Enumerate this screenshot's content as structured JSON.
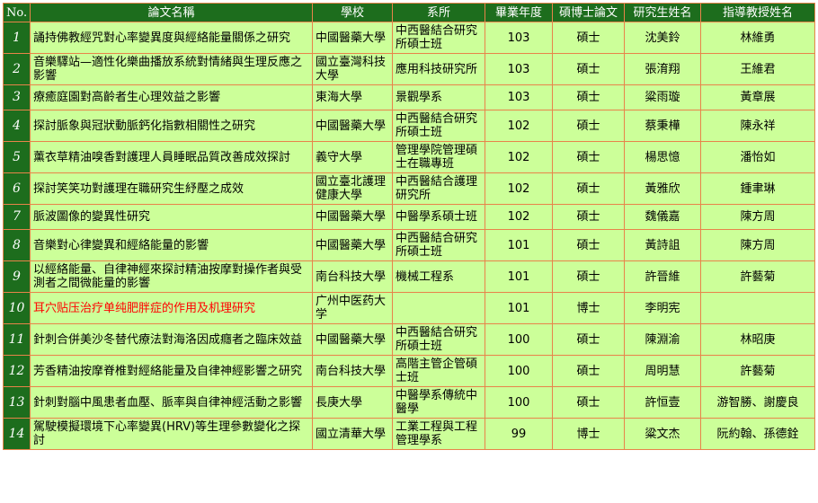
{
  "colors": {
    "header_bg": "#1d6d1d",
    "header_text": "#ffffff",
    "cell_bg": "#ccff99",
    "border": "#e8834a",
    "highlight_text": "#ff0000"
  },
  "table": {
    "headers": [
      "No.",
      "論文名稱",
      "學校",
      "系所",
      "畢業年度",
      "碩博士論文",
      "研究生姓名",
      "指導教授姓名"
    ],
    "rows": [
      {
        "no": "1",
        "title": "誦持佛教經咒對心率變異度與經絡能量關係之研究",
        "school": "中國醫藥大學",
        "dept": "中西醫結合研究所碩士班",
        "year": "103",
        "degree": "碩士",
        "student": "沈美鈴",
        "advisor": "林維勇"
      },
      {
        "no": "2",
        "title": "音樂驛站—適性化樂曲播放系統對情緒與生理反應之影響",
        "school": "國立臺灣科技大學",
        "dept": "應用科技研究所",
        "year": "103",
        "degree": "碩士",
        "student": "張淯翔",
        "advisor": "王維君"
      },
      {
        "no": "3",
        "title": "療癒庭園對高齡者生心理效益之影響",
        "school": "東海大學",
        "dept": "景觀學系",
        "year": "103",
        "degree": "碩士",
        "student": "粱雨璇",
        "advisor": "黃章展"
      },
      {
        "no": "4",
        "title": "探討脈象與冠狀動脈鈣化指數相關性之研究",
        "school": "中國醫藥大學",
        "dept": "中西醫結合研究所碩士班",
        "year": "102",
        "degree": "碩士",
        "student": "蔡秉樺",
        "advisor": "陳永祥"
      },
      {
        "no": "5",
        "title": "薰衣草精油嗅香對護理人員睡眠品質改善成效探討",
        "school": "義守大學",
        "dept": "管理學院管理碩士在職專班",
        "year": "102",
        "degree": "碩士",
        "student": "楊思憶",
        "advisor": "潘怡如"
      },
      {
        "no": "6",
        "title": "探討笑笑功對護理在職研究生紓壓之成效",
        "school": "國立臺北護理健康大學",
        "dept": "中西醫結合護理研究所",
        "year": "102",
        "degree": "碩士",
        "student": "黃雅欣",
        "advisor": "鍾聿琳"
      },
      {
        "no": "7",
        "title": "脈波圖像的變異性研究",
        "school": "中國醫藥大學",
        "dept": "中醫學系碩士班",
        "year": "102",
        "degree": "碩士",
        "student": "魏儀嘉",
        "advisor": "陳方周"
      },
      {
        "no": "8",
        "title": "音樂對心律變異和經絡能量的影響",
        "school": "中國醫藥大學",
        "dept": "中西醫結合研究所碩士班",
        "year": "101",
        "degree": "碩士",
        "student": "黃詩詛",
        "advisor": "陳方周"
      },
      {
        "no": "9",
        "title": "以經絡能量、自律神經來探討精油按摩對操作者與受測者之間微能量的影響",
        "school": "南台科技大學",
        "dept": "機械工程系",
        "year": "101",
        "degree": "碩士",
        "student": "許晉維",
        "advisor": "許藝菊"
      },
      {
        "no": "10",
        "title": "耳穴贴压治疗单纯肥胖症的作用及机理研究",
        "school": "广州中医药大学",
        "dept": "",
        "year": "101",
        "degree": "博士",
        "student": "李明宪",
        "advisor": ""
      },
      {
        "no": "11",
        "title": "針刺合併美沙冬替代療法對海洛因成癮者之臨床效益",
        "school": "中國醫藥大學",
        "dept": "中西醫結合研究所碩士班",
        "year": "100",
        "degree": "碩士",
        "student": "陳淵渝",
        "advisor": "林昭庚"
      },
      {
        "no": "12",
        "title": "芳香精油按摩脊椎對經絡能量及自律神經影響之研究",
        "school": "南台科技大學",
        "dept": "高階主管企管碩士班",
        "year": "100",
        "degree": "碩士",
        "student": "周明慧",
        "advisor": "許藝菊"
      },
      {
        "no": "13",
        "title": "針刺對腦中風患者血壓、脈率與自律神經活動之影響",
        "school": "長庚大學",
        "dept": "中醫學系傳統中醫學",
        "year": "100",
        "degree": "碩士",
        "student": "許恒壹",
        "advisor": "游智勝、謝慶良"
      },
      {
        "no": "14",
        "title": "駕駛模擬環境下心率變異(HRV)等生理參數變化之探討",
        "school": "國立清華大學",
        "dept": "工業工程與工程管理學系",
        "year": "99",
        "degree": "博士",
        "student": "粱文杰",
        "advisor": "阮約翰、孫德銓"
      }
    ]
  }
}
